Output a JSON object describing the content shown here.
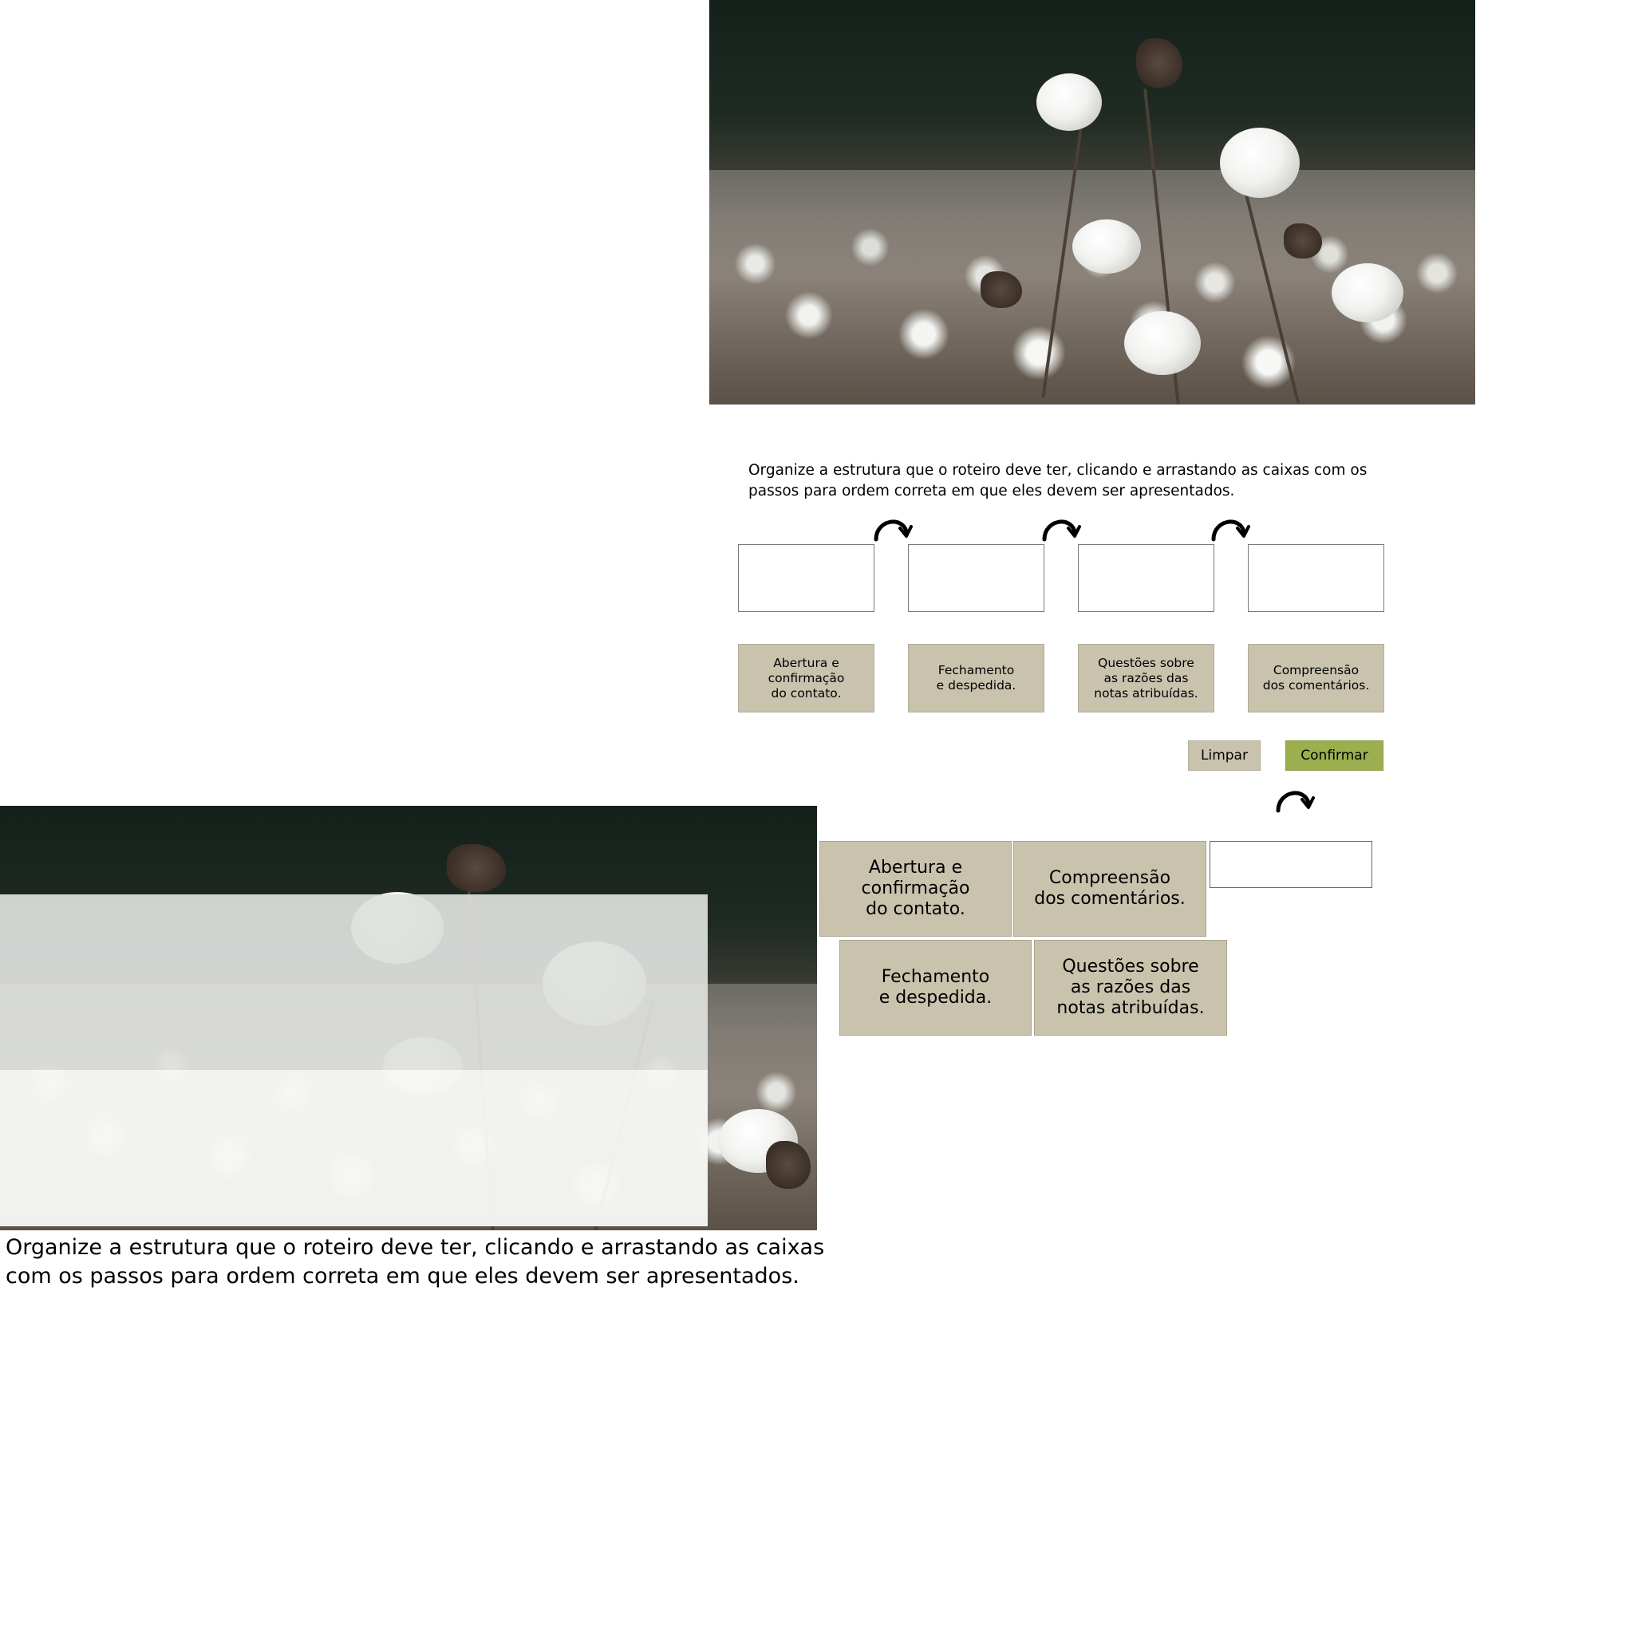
{
  "instructions": "Organize a estrutura que o roteiro deve ter, clicando e arrastando as caixas com os passos para ordem correta em que eles devem ser apresentados.",
  "cards": [
    {
      "label": "Abertura e\nconfirmação\ndo contato."
    },
    {
      "label": "Fechamento\ne despedida."
    },
    {
      "label": "Questões sobre\nas razões das\nnotas atribuídas."
    },
    {
      "label": "Compreensão\ndos comentários."
    }
  ],
  "buttons": {
    "clear": "Limpar",
    "confirm": "Confirmar"
  },
  "colors": {
    "card": "#c9c3ae",
    "confirm": "#9caf4e",
    "slot_border": "#7a7a7a"
  },
  "icons": {
    "step_arrow": "curved-arrow-icon",
    "photo": "cotton-field-photo"
  }
}
